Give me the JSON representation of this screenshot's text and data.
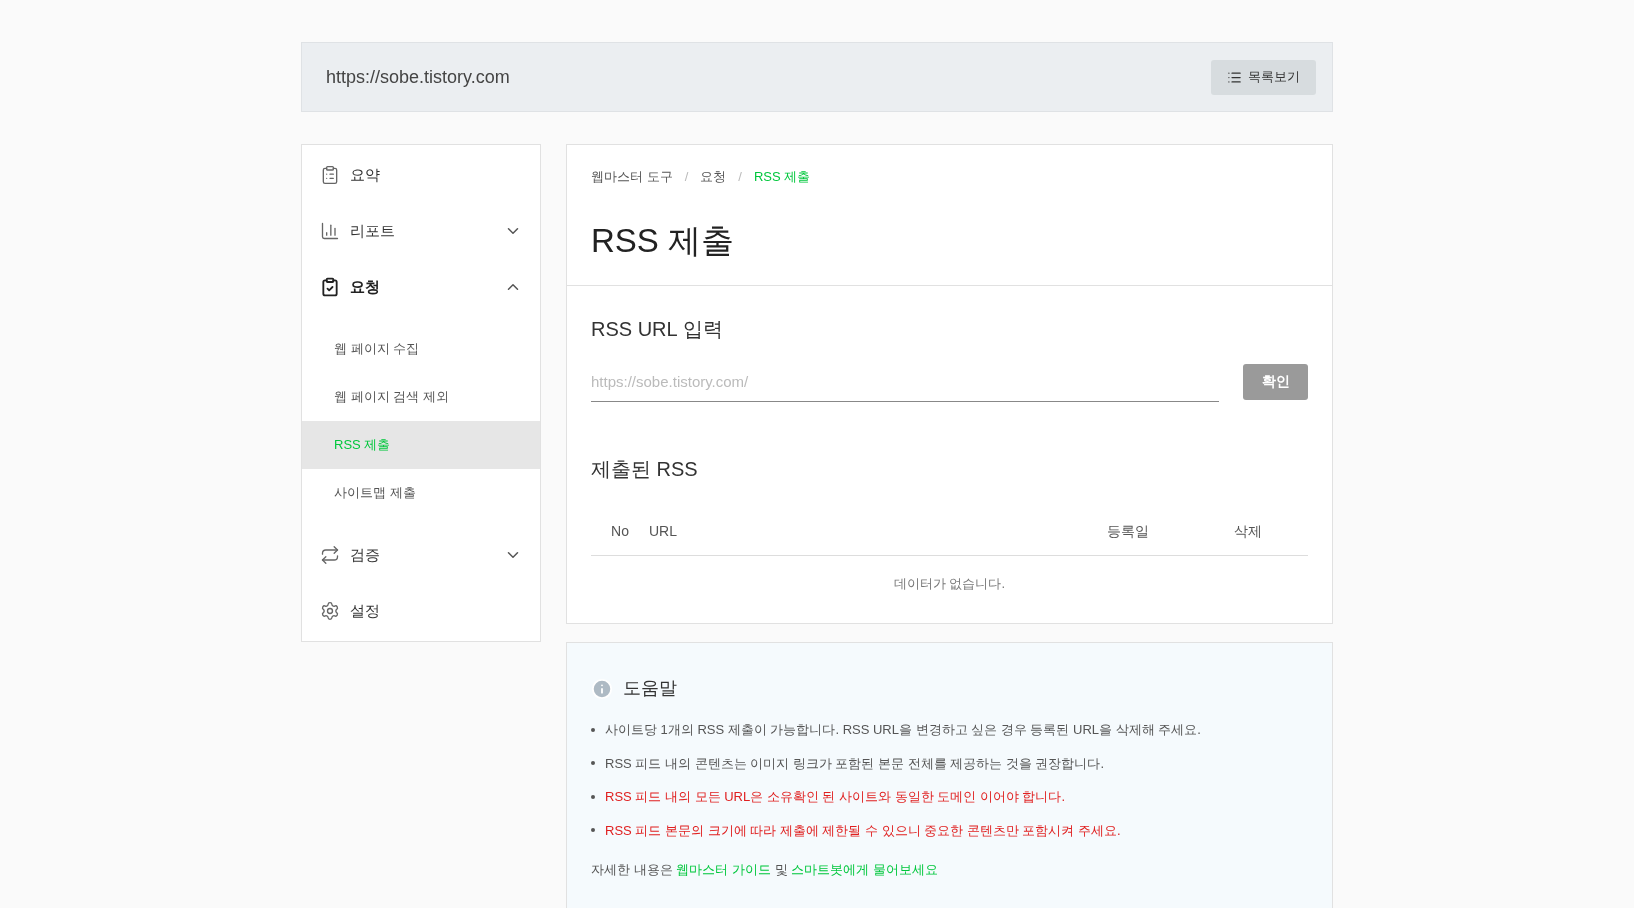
{
  "header": {
    "url": "https://sobe.tistory.com",
    "list_button": "목록보기"
  },
  "sidebar": {
    "items": [
      {
        "label": "요약",
        "kind": "link",
        "selected": false
      },
      {
        "label": "리포트",
        "kind": "group",
        "selected": false,
        "expanded": false
      },
      {
        "label": "요청",
        "kind": "group",
        "selected": true,
        "expanded": true,
        "children": [
          {
            "label": "웹 페이지 수집",
            "selected": false
          },
          {
            "label": "웹 페이지 검색 제외",
            "selected": false
          },
          {
            "label": "RSS 제출",
            "selected": true
          },
          {
            "label": "사이트맵 제출",
            "selected": false
          }
        ]
      },
      {
        "label": "검증",
        "kind": "group",
        "selected": false,
        "expanded": false
      },
      {
        "label": "설정",
        "kind": "link",
        "selected": false
      }
    ]
  },
  "breadcrumb": [
    {
      "label": "웹마스터 도구",
      "selected": false
    },
    {
      "label": "요청",
      "selected": false
    },
    {
      "label": "RSS 제출",
      "selected": true
    }
  ],
  "breadcrumb_separator": "/",
  "page_title": "RSS 제출",
  "rss_input": {
    "title": "RSS URL 입력",
    "placeholder": "https://sobe.tistory.com/",
    "button": "확인",
    "disabled": true
  },
  "submitted": {
    "title": "제출된 RSS",
    "columns": [
      "No",
      "URL",
      "등록일",
      "삭제"
    ],
    "empty_message": "데이터가 없습니다."
  },
  "help": {
    "title": "도움말",
    "items": [
      {
        "text": "사이트당 1개의 RSS 제출이 가능합니다. RSS URL을 변경하고 싶은 경우 등록된 URL을 삭제해 주세요.",
        "kind": "normal"
      },
      {
        "text": "RSS 피드 내의 콘텐츠는 이미지 링크가 포함된 본문 전체를 제공하는 것을 권장합니다.",
        "kind": "normal"
      },
      {
        "text": "RSS 피드 내의 모든 URL은 소유확인 된 사이트와 동일한 도메인 이어야 합니다.",
        "kind": "warning"
      },
      {
        "text": "RSS 피드 본문의 크기에 따라 제출에 제한될 수 있으니 중요한 콘텐츠만 포함시켜 주세요.",
        "kind": "warning"
      }
    ],
    "footer": {
      "before": "자세한 내용은",
      "link1": "웹마스터 가이드",
      "middle": "및",
      "link2": "스마트봇에게 물어보세요"
    }
  }
}
